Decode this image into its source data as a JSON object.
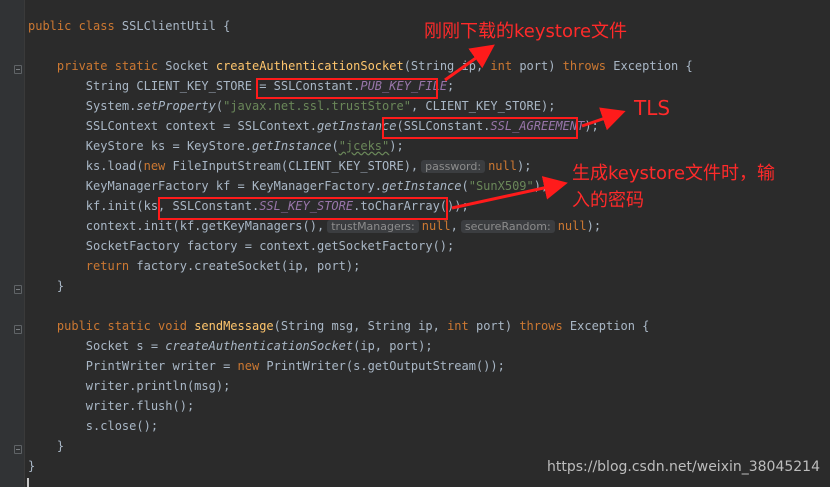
{
  "code_lines": [
    {
      "id": "class-decl",
      "parts": [
        {
          "t": "public class ",
          "c": "kw"
        },
        {
          "t": "SSLClientUtil {",
          "c": ""
        }
      ]
    },
    {
      "id": "blank-1",
      "parts": []
    },
    {
      "id": "method-create",
      "parts": [
        {
          "t": "    "
        },
        {
          "t": "private static ",
          "c": "kw"
        },
        {
          "t": "Socket "
        },
        {
          "t": "createAuthenticationSocket",
          "c": "fn"
        },
        {
          "t": "(String ip, "
        },
        {
          "t": "int ",
          "c": "kw"
        },
        {
          "t": "port) "
        },
        {
          "t": "throws ",
          "c": "kw"
        },
        {
          "t": "Exception {"
        }
      ]
    },
    {
      "id": "line-keystore",
      "parts": [
        {
          "t": "        String CLIENT_KEY_STORE = SSLConstant."
        },
        {
          "t": "PUB_KEY_FILE",
          "c": "const"
        },
        {
          "t": ";"
        }
      ]
    },
    {
      "id": "line-setprop",
      "parts": [
        {
          "t": "        System."
        },
        {
          "t": "setProperty",
          "c": "it"
        },
        {
          "t": "("
        },
        {
          "t": "\"javax.net.ssl.trustStore\"",
          "c": "str"
        },
        {
          "t": ", CLIENT_KEY_STORE);"
        }
      ]
    },
    {
      "id": "line-sslcontext",
      "parts": [
        {
          "t": "        SSLContext context = SSLContext."
        },
        {
          "t": "getInstance",
          "c": "it"
        },
        {
          "t": "(SSLConstant."
        },
        {
          "t": "SSL_AGREEMENT",
          "c": "const"
        },
        {
          "t": ");"
        }
      ]
    },
    {
      "id": "line-ks",
      "parts": [
        {
          "t": "        KeyStore ks = KeyStore."
        },
        {
          "t": "getInstance",
          "c": "it"
        },
        {
          "t": "("
        },
        {
          "t": "\"jceks\"",
          "c": "str-u"
        },
        {
          "t": ");"
        }
      ]
    },
    {
      "id": "line-ksload",
      "parts": [
        {
          "t": "        ks.load("
        },
        {
          "t": "new ",
          "c": "kw"
        },
        {
          "t": "FileInputStream(CLIENT_KEY_STORE),"
        },
        {
          "t": "password:",
          "c": "hint"
        },
        {
          "t": "null",
          "c": "kw"
        },
        {
          "t": ");"
        }
      ]
    },
    {
      "id": "line-kmf",
      "parts": [
        {
          "t": "        KeyManagerFactory kf = KeyManagerFactory."
        },
        {
          "t": "getInstance",
          "c": "it"
        },
        {
          "t": "("
        },
        {
          "t": "\"SunX509\"",
          "c": "str"
        },
        {
          "t": ");"
        }
      ]
    },
    {
      "id": "line-kfinit",
      "parts": [
        {
          "t": "        kf.init(ks, SSLConstant."
        },
        {
          "t": "SSL_KEY_STORE",
          "c": "const"
        },
        {
          "t": ".toCharArray());"
        }
      ]
    },
    {
      "id": "line-ctxinit",
      "parts": [
        {
          "t": "        context.init(kf.getKeyManagers(),"
        },
        {
          "t": "trustManagers:",
          "c": "hint"
        },
        {
          "t": "null",
          "c": "kw"
        },
        {
          "t": ","
        },
        {
          "t": "secureRandom:",
          "c": "hint"
        },
        {
          "t": "null",
          "c": "kw"
        },
        {
          "t": ");"
        }
      ]
    },
    {
      "id": "line-factory",
      "parts": [
        {
          "t": "        SocketFactory factory = context.getSocketFactory();"
        }
      ]
    },
    {
      "id": "line-return",
      "parts": [
        {
          "t": "        "
        },
        {
          "t": "return ",
          "c": "kw"
        },
        {
          "t": "factory.createSocket(ip, port);"
        }
      ]
    },
    {
      "id": "close-create",
      "parts": [
        {
          "t": "    }"
        }
      ]
    },
    {
      "id": "blank-2",
      "parts": []
    },
    {
      "id": "method-send",
      "parts": [
        {
          "t": "    "
        },
        {
          "t": "public static void ",
          "c": "kw"
        },
        {
          "t": "sendMessage",
          "c": "fn"
        },
        {
          "t": "(String msg, String ip, "
        },
        {
          "t": "int ",
          "c": "kw"
        },
        {
          "t": "port) "
        },
        {
          "t": "throws ",
          "c": "kw"
        },
        {
          "t": "Exception {"
        }
      ]
    },
    {
      "id": "line-socket",
      "parts": [
        {
          "t": "        Socket s = "
        },
        {
          "t": "createAuthenticationSocket",
          "c": "it"
        },
        {
          "t": "(ip, port);"
        }
      ]
    },
    {
      "id": "line-writer",
      "parts": [
        {
          "t": "        PrintWriter writer = "
        },
        {
          "t": "new ",
          "c": "kw"
        },
        {
          "t": "PrintWriter(s.getOutputStream());"
        }
      ]
    },
    {
      "id": "line-println",
      "parts": [
        {
          "t": "        writer.println(msg);"
        }
      ]
    },
    {
      "id": "line-flush",
      "parts": [
        {
          "t": "        writer.flush();"
        }
      ]
    },
    {
      "id": "line-close",
      "parts": [
        {
          "t": "        s.close();"
        }
      ]
    },
    {
      "id": "close-send",
      "parts": [
        {
          "t": "    }"
        }
      ]
    },
    {
      "id": "close-class",
      "parts": [
        {
          "t": "}"
        }
      ]
    }
  ],
  "annotations": {
    "keystore_file": "刚刚下载的keystore文件",
    "tls": "TLS",
    "password_line1": "生成keystore文件时，输",
    "password_line2": "入的密码"
  },
  "colors": {
    "annotation_red": "#ff1b1b",
    "background": "#2b2b2b"
  },
  "watermark": "https://blog.csdn.net/weixin_38045214"
}
